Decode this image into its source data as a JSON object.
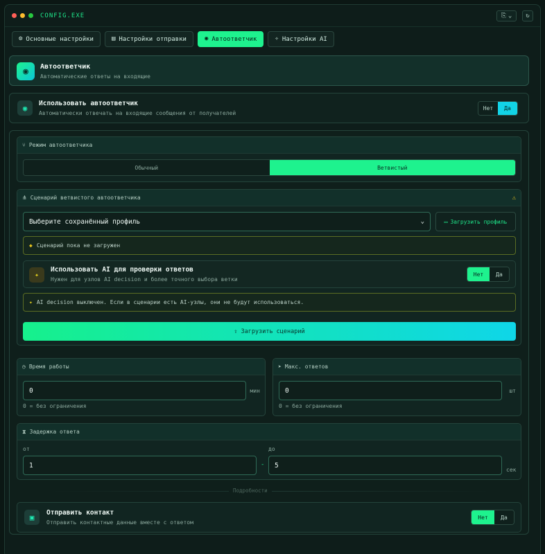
{
  "window": {
    "title": "CONFIG.EXE",
    "dots": [
      "#ff5f57",
      "#febc2e",
      "#28c840"
    ],
    "bookmark_icon": "bookmark-icon",
    "chevron_icon": "chevron-down-icon",
    "refresh_icon": "refresh-icon"
  },
  "tabs": [
    {
      "label": "Основные настройки",
      "icon": "gear-icon",
      "active": false
    },
    {
      "label": "Настройки отправки",
      "icon": "send-icon",
      "active": false
    },
    {
      "label": "Автоответчик",
      "icon": "robot-icon",
      "active": true
    },
    {
      "label": "Настройки AI",
      "icon": "sparkle-icon",
      "active": false
    }
  ],
  "header": {
    "title": "Автоответчик",
    "subtitle": "Автоматические ответы на входящие"
  },
  "use_autoresponder": {
    "title": "Использовать автоответчик",
    "subtitle": "Автоматически отвечать на входящие сообщения от получателей",
    "no": "Нет",
    "yes": "Да",
    "selected": "Да"
  },
  "mode": {
    "heading": "Режим автоответчика",
    "options": [
      "Обычный",
      "Ветвистый"
    ],
    "selected": "Ветвистый"
  },
  "scenario": {
    "heading": "Сценарий ветвистого автоответчика",
    "select_value": "Выберите сохранённый профиль",
    "load_profile": "Загрузить профиль",
    "not_loaded": "Сценарий пока не загружен",
    "ai_title": "Использовать AI для проверки ответов",
    "ai_subtitle": "Нужен для узлов AI decision и более точного выбора ветки",
    "ai_no": "Нет",
    "ai_yes": "Да",
    "ai_selected": "Нет",
    "ai_notice": "AI decision выключен. Если в сценарии есть AI-узлы, они не будут использоваться.",
    "upload": "Загрузить сценарий"
  },
  "work_time": {
    "heading": "Время работы",
    "value": "0",
    "unit": "мин",
    "hint": "0 = без ограничения"
  },
  "max_replies": {
    "heading": "Макс. ответов",
    "value": "0",
    "unit": "шт",
    "hint": "0 = без ограничения"
  },
  "delay": {
    "heading": "Задержка ответа",
    "from_label": "от",
    "to_label": "до",
    "from_value": "1",
    "to_value": "5",
    "dash": "-",
    "unit": "сек"
  },
  "divider_label": "Подробности",
  "contact": {
    "title": "Отправить контакт",
    "subtitle": "Отправить контактные данные вместе с ответом",
    "no": "Нет",
    "yes": "Да",
    "selected": "Нет"
  },
  "colors": {
    "accent_green": "#1ef28e",
    "accent_cyan": "#12d3e6",
    "warning": "#e6c21e"
  }
}
